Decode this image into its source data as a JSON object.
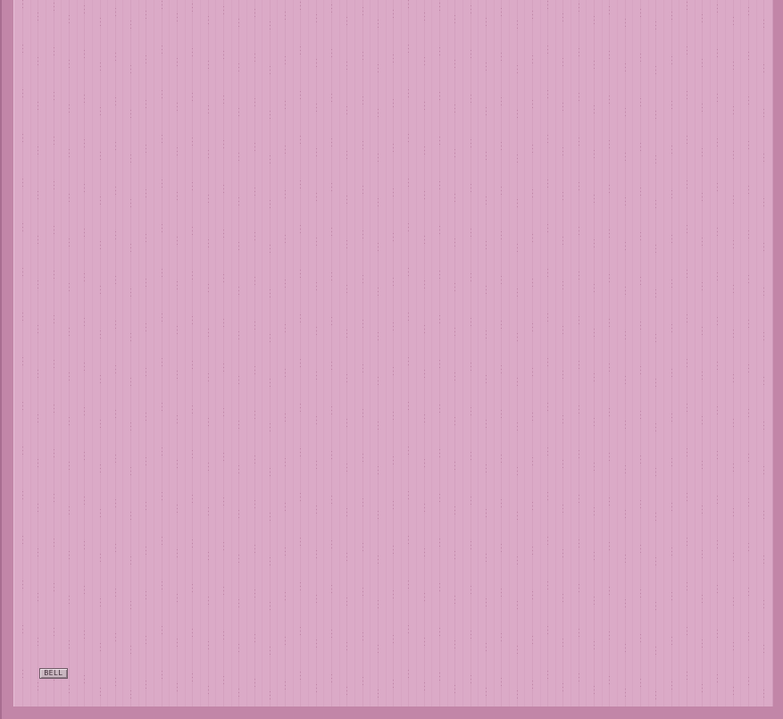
{
  "theme": {
    "frame_color": "#c286a8",
    "panel_color": "#dbaac7",
    "line_color": "#c98fb1",
    "dot_color": "#a8668d",
    "tag_fill": "#c9b6c0"
  },
  "canvas": {
    "tag_label": "BELL"
  }
}
